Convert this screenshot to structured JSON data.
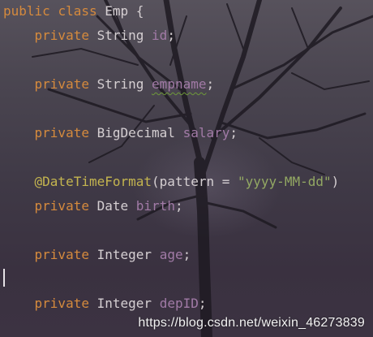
{
  "code": {
    "l1": {
      "kw1": "public",
      "kw2": "class",
      "name": "Emp",
      "brace": "{"
    },
    "l2": {
      "kw": "private",
      "type": "String",
      "field": "id",
      "end": ";"
    },
    "l3": {
      "kw": "private",
      "type": "String",
      "field": "empname",
      "end": ";"
    },
    "l4": {
      "kw": "private",
      "type": "BigDecimal",
      "field": "salary",
      "end": ";"
    },
    "l5": {
      "annotation": "@DateTimeFormat",
      "open": "(",
      "param": "pattern",
      "eq": " = ",
      "value": "\"yyyy-MM-dd\"",
      "close": ")"
    },
    "l6": {
      "kw": "private",
      "type": "Date",
      "field": "birth",
      "end": ";"
    },
    "l7": {
      "kw": "private",
      "type": "Integer",
      "field": "age",
      "end": ";"
    },
    "l8": {
      "kw": "private",
      "type": "Integer",
      "field": "depID",
      "end": ";"
    }
  },
  "watermark": "https://blog.csdn.net/weixin_46273839",
  "colors": {
    "keyword": "#d58a3d",
    "field": "#a17aa6",
    "annotation": "#c4b54f",
    "string": "#93a863",
    "text": "#d5cfd2"
  }
}
